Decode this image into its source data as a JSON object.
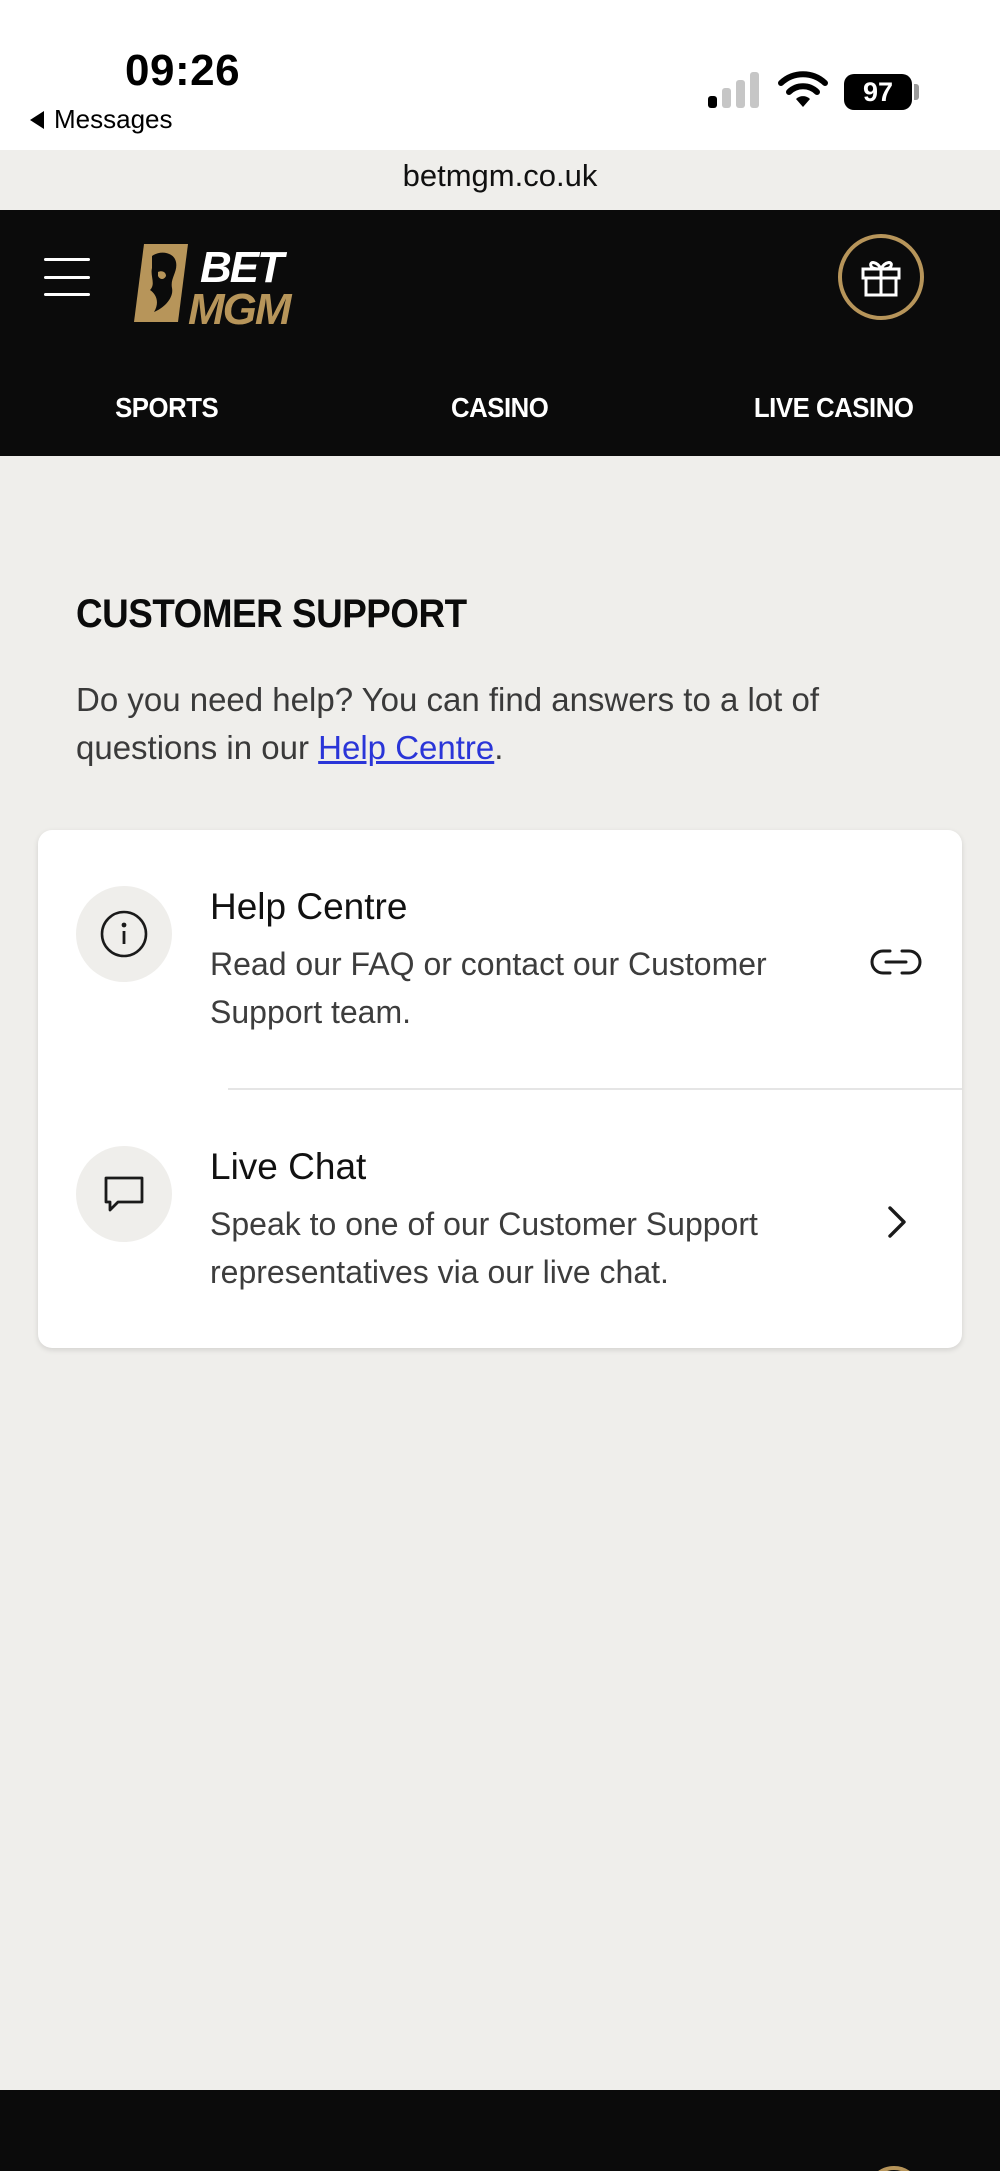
{
  "status_bar": {
    "time": "09:26",
    "back_label": "Messages",
    "battery": "97",
    "url": "betmgm.co.uk"
  },
  "header": {
    "logo_text": "BETMGM",
    "nav": [
      "SPORTS",
      "CASINO",
      "LIVE CASINO"
    ]
  },
  "main": {
    "title": "CUSTOMER SUPPORT",
    "intro_text": "Do you need help? You can find answers to a lot of questions in our ",
    "intro_link": "Help Centre",
    "intro_end": ".",
    "options": [
      {
        "title": "Help Centre",
        "description": "Read our FAQ or contact our Customer Support team.",
        "icon": "info-icon",
        "action_icon": "link-icon"
      },
      {
        "title": "Live Chat",
        "description": "Speak to one of our Customer Support representatives via our live chat.",
        "icon": "chat-bubble-icon",
        "action_icon": "chevron-right-icon"
      }
    ]
  },
  "colors": {
    "brand_gold": "#b7955a",
    "header_bg": "#0b0b0b",
    "page_bg": "#efeeeb",
    "link": "#2a35d8"
  }
}
